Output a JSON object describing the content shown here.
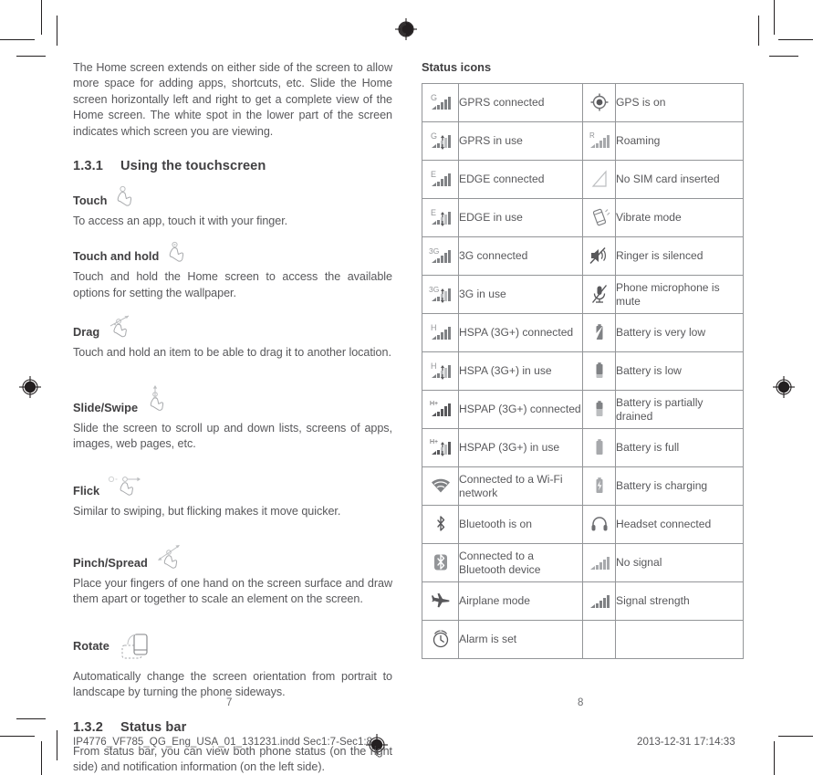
{
  "document": {
    "left_page": {
      "page_number": "7",
      "intro_paragraph": "The Home screen extends on either side of the screen to allow more space for adding apps, shortcuts, etc. Slide the Home screen horizontally left and right to get a complete view of the Home screen. The white spot in the lower part of the screen indicates which screen you are viewing.",
      "sections": [
        {
          "number": "1.3.1",
          "title": "Using the touchscreen",
          "gestures": [
            {
              "name": "Touch",
              "icon": "hand-touch-icon",
              "text": "To access an app, touch it with your finger."
            },
            {
              "name": "Touch and hold",
              "icon": "hand-touch-hold-icon",
              "text": "Touch and hold the Home screen to access the available options for setting the wallpaper."
            },
            {
              "name": "Drag",
              "icon": "hand-drag-icon",
              "text": "Touch and hold an item to be able to drag it to another location."
            },
            {
              "name": "Slide/Swipe",
              "icon": "hand-slide-swipe-icon",
              "text": "Slide the screen to scroll up and down lists, screens of apps, images, web pages, etc."
            },
            {
              "name": "Flick",
              "icon": "hand-flick-icon",
              "text": "Similar to swiping, but flicking makes it move quicker."
            },
            {
              "name": "Pinch/Spread",
              "icon": "hand-pinch-spread-icon",
              "text": "Place your fingers of one hand on the screen surface and draw them apart or together to scale an element on the screen."
            },
            {
              "name": "Rotate",
              "icon": "device-rotate-icon",
              "text": "Automatically change the screen orientation from portrait to landscape by turning the phone sideways."
            }
          ]
        },
        {
          "number": "1.3.2",
          "title": "Status bar",
          "text": "From status bar, you can view both phone status (on the right side) and notification information (on the left side)."
        }
      ]
    },
    "right_page": {
      "page_number": "8",
      "table_title": "Status icons",
      "rows": [
        {
          "left_icon": "signal-gprs-connected-icon",
          "left_label": "GPRS connected",
          "right_icon": "gps-on-icon",
          "right_label": "GPS is on"
        },
        {
          "left_icon": "signal-gprs-in-use-icon",
          "left_label": "GPRS in use",
          "right_icon": "roaming-icon",
          "right_label": "Roaming"
        },
        {
          "left_icon": "signal-edge-connected-icon",
          "left_label": "EDGE connected",
          "right_icon": "no-sim-card-icon",
          "right_label": "No SIM card inserted"
        },
        {
          "left_icon": "signal-edge-in-use-icon",
          "left_label": "EDGE in use",
          "right_icon": "vibrate-mode-icon",
          "right_label": "Vibrate mode"
        },
        {
          "left_icon": "signal-3g-connected-icon",
          "left_label": "3G connected",
          "right_icon": "ringer-silenced-icon",
          "right_label": "Ringer is silenced"
        },
        {
          "left_icon": "signal-3g-in-use-icon",
          "left_label": "3G in use",
          "right_icon": "microphone-mute-icon",
          "right_label": "Phone microphone is mute"
        },
        {
          "left_icon": "signal-hspa-connected-icon",
          "left_label": "HSPA (3G+) connected",
          "right_icon": "battery-very-low-icon",
          "right_label": "Battery is very low"
        },
        {
          "left_icon": "signal-hspa-in-use-icon",
          "left_label": "HSPA (3G+) in use",
          "right_icon": "battery-low-icon",
          "right_label": "Battery is low"
        },
        {
          "left_icon": "signal-hspap-connected-icon",
          "left_label": "HSPAP (3G+) connected",
          "right_icon": "battery-partial-icon",
          "right_label": "Battery is partially drained"
        },
        {
          "left_icon": "signal-hspap-in-use-icon",
          "left_label": "HSPAP (3G+) in use",
          "right_icon": "battery-full-icon",
          "right_label": "Battery is full"
        },
        {
          "left_icon": "wifi-connected-icon",
          "left_label": "Connected to a Wi-Fi network",
          "right_icon": "battery-charging-icon",
          "right_label": "Battery is charging"
        },
        {
          "left_icon": "bluetooth-on-icon",
          "left_label": "Bluetooth is on",
          "right_icon": "headset-connected-icon",
          "right_label": "Headset connected"
        },
        {
          "left_icon": "bluetooth-connected-icon",
          "left_label": "Connected to a Bluetooth device",
          "right_icon": "no-signal-icon",
          "right_label": "No signal"
        },
        {
          "left_icon": "airplane-mode-icon",
          "left_label": "Airplane mode",
          "right_icon": "signal-strength-icon",
          "right_label": "Signal strength"
        },
        {
          "left_icon": "alarm-set-icon",
          "left_label": "Alarm is set",
          "right_icon": "",
          "right_label": ""
        }
      ]
    },
    "footer": {
      "file_info": "IP4776_VF785_QG_Eng_USA_01_131231.indd   Sec1:7-Sec1:8",
      "timestamp": "2013-12-31   17:14:33"
    }
  },
  "colors": {
    "body_text": "#58585b",
    "heading_text": "#414042",
    "table_border": "#939598",
    "icon_gray": "#808285",
    "mark_black": "#231f20"
  }
}
